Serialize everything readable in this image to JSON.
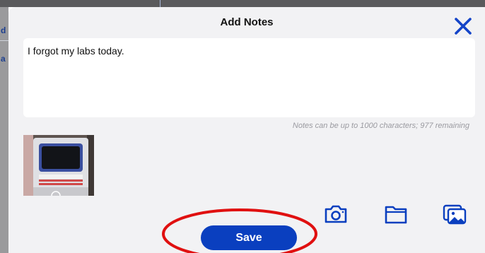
{
  "background_app": {
    "fragment_1": "d",
    "fragment_2": "a"
  },
  "modal": {
    "title": "Add Notes",
    "close_icon": "close-icon",
    "notes_value": "I forgot my labs today.",
    "char_note": "Notes can be up to 1000 characters; 977 remaining",
    "attachment_alt": "attachment-thumbnail",
    "tools": {
      "camera_icon": "camera-icon",
      "folder_icon": "folder-icon",
      "gallery_icon": "photo-gallery-icon"
    },
    "save_label": "Save"
  },
  "colors": {
    "accent": "#0a3fbf",
    "close_x": "#1444c8",
    "annotation_ring": "#e01010",
    "modal_bg": "#f2f2f4"
  }
}
